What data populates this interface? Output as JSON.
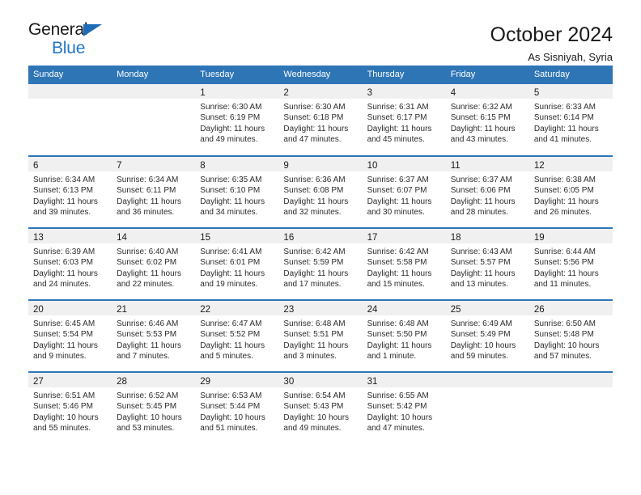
{
  "brand": {
    "name_dark": "General",
    "name_blue": "Blue",
    "accent_color": "#2277c8",
    "triangle_color": "#1e6bb8"
  },
  "header": {
    "title": "October 2024",
    "subtitle": "As Sisniyah, Syria"
  },
  "theme": {
    "header_bar_color": "#2e75b6",
    "daynum_band_color": "#f0f0f0",
    "row_divider_color": "#2e75b6"
  },
  "weekday_headers": [
    "Sunday",
    "Monday",
    "Tuesday",
    "Wednesday",
    "Thursday",
    "Friday",
    "Saturday"
  ],
  "weeks": [
    [
      {
        "day": "",
        "lines": []
      },
      {
        "day": "",
        "lines": []
      },
      {
        "day": "1",
        "lines": [
          "Sunrise: 6:30 AM",
          "Sunset: 6:19 PM",
          "Daylight: 11 hours",
          "and 49 minutes."
        ]
      },
      {
        "day": "2",
        "lines": [
          "Sunrise: 6:30 AM",
          "Sunset: 6:18 PM",
          "Daylight: 11 hours",
          "and 47 minutes."
        ]
      },
      {
        "day": "3",
        "lines": [
          "Sunrise: 6:31 AM",
          "Sunset: 6:17 PM",
          "Daylight: 11 hours",
          "and 45 minutes."
        ]
      },
      {
        "day": "4",
        "lines": [
          "Sunrise: 6:32 AM",
          "Sunset: 6:15 PM",
          "Daylight: 11 hours",
          "and 43 minutes."
        ]
      },
      {
        "day": "5",
        "lines": [
          "Sunrise: 6:33 AM",
          "Sunset: 6:14 PM",
          "Daylight: 11 hours",
          "and 41 minutes."
        ]
      }
    ],
    [
      {
        "day": "6",
        "lines": [
          "Sunrise: 6:34 AM",
          "Sunset: 6:13 PM",
          "Daylight: 11 hours",
          "and 39 minutes."
        ]
      },
      {
        "day": "7",
        "lines": [
          "Sunrise: 6:34 AM",
          "Sunset: 6:11 PM",
          "Daylight: 11 hours",
          "and 36 minutes."
        ]
      },
      {
        "day": "8",
        "lines": [
          "Sunrise: 6:35 AM",
          "Sunset: 6:10 PM",
          "Daylight: 11 hours",
          "and 34 minutes."
        ]
      },
      {
        "day": "9",
        "lines": [
          "Sunrise: 6:36 AM",
          "Sunset: 6:08 PM",
          "Daylight: 11 hours",
          "and 32 minutes."
        ]
      },
      {
        "day": "10",
        "lines": [
          "Sunrise: 6:37 AM",
          "Sunset: 6:07 PM",
          "Daylight: 11 hours",
          "and 30 minutes."
        ]
      },
      {
        "day": "11",
        "lines": [
          "Sunrise: 6:37 AM",
          "Sunset: 6:06 PM",
          "Daylight: 11 hours",
          "and 28 minutes."
        ]
      },
      {
        "day": "12",
        "lines": [
          "Sunrise: 6:38 AM",
          "Sunset: 6:05 PM",
          "Daylight: 11 hours",
          "and 26 minutes."
        ]
      }
    ],
    [
      {
        "day": "13",
        "lines": [
          "Sunrise: 6:39 AM",
          "Sunset: 6:03 PM",
          "Daylight: 11 hours",
          "and 24 minutes."
        ]
      },
      {
        "day": "14",
        "lines": [
          "Sunrise: 6:40 AM",
          "Sunset: 6:02 PM",
          "Daylight: 11 hours",
          "and 22 minutes."
        ]
      },
      {
        "day": "15",
        "lines": [
          "Sunrise: 6:41 AM",
          "Sunset: 6:01 PM",
          "Daylight: 11 hours",
          "and 19 minutes."
        ]
      },
      {
        "day": "16",
        "lines": [
          "Sunrise: 6:42 AM",
          "Sunset: 5:59 PM",
          "Daylight: 11 hours",
          "and 17 minutes."
        ]
      },
      {
        "day": "17",
        "lines": [
          "Sunrise: 6:42 AM",
          "Sunset: 5:58 PM",
          "Daylight: 11 hours",
          "and 15 minutes."
        ]
      },
      {
        "day": "18",
        "lines": [
          "Sunrise: 6:43 AM",
          "Sunset: 5:57 PM",
          "Daylight: 11 hours",
          "and 13 minutes."
        ]
      },
      {
        "day": "19",
        "lines": [
          "Sunrise: 6:44 AM",
          "Sunset: 5:56 PM",
          "Daylight: 11 hours",
          "and 11 minutes."
        ]
      }
    ],
    [
      {
        "day": "20",
        "lines": [
          "Sunrise: 6:45 AM",
          "Sunset: 5:54 PM",
          "Daylight: 11 hours",
          "and 9 minutes."
        ]
      },
      {
        "day": "21",
        "lines": [
          "Sunrise: 6:46 AM",
          "Sunset: 5:53 PM",
          "Daylight: 11 hours",
          "and 7 minutes."
        ]
      },
      {
        "day": "22",
        "lines": [
          "Sunrise: 6:47 AM",
          "Sunset: 5:52 PM",
          "Daylight: 11 hours",
          "and 5 minutes."
        ]
      },
      {
        "day": "23",
        "lines": [
          "Sunrise: 6:48 AM",
          "Sunset: 5:51 PM",
          "Daylight: 11 hours",
          "and 3 minutes."
        ]
      },
      {
        "day": "24",
        "lines": [
          "Sunrise: 6:48 AM",
          "Sunset: 5:50 PM",
          "Daylight: 11 hours",
          "and 1 minute."
        ]
      },
      {
        "day": "25",
        "lines": [
          "Sunrise: 6:49 AM",
          "Sunset: 5:49 PM",
          "Daylight: 10 hours",
          "and 59 minutes."
        ]
      },
      {
        "day": "26",
        "lines": [
          "Sunrise: 6:50 AM",
          "Sunset: 5:48 PM",
          "Daylight: 10 hours",
          "and 57 minutes."
        ]
      }
    ],
    [
      {
        "day": "27",
        "lines": [
          "Sunrise: 6:51 AM",
          "Sunset: 5:46 PM",
          "Daylight: 10 hours",
          "and 55 minutes."
        ]
      },
      {
        "day": "28",
        "lines": [
          "Sunrise: 6:52 AM",
          "Sunset: 5:45 PM",
          "Daylight: 10 hours",
          "and 53 minutes."
        ]
      },
      {
        "day": "29",
        "lines": [
          "Sunrise: 6:53 AM",
          "Sunset: 5:44 PM",
          "Daylight: 10 hours",
          "and 51 minutes."
        ]
      },
      {
        "day": "30",
        "lines": [
          "Sunrise: 6:54 AM",
          "Sunset: 5:43 PM",
          "Daylight: 10 hours",
          "and 49 minutes."
        ]
      },
      {
        "day": "31",
        "lines": [
          "Sunrise: 6:55 AM",
          "Sunset: 5:42 PM",
          "Daylight: 10 hours",
          "and 47 minutes."
        ]
      },
      {
        "day": "",
        "lines": []
      },
      {
        "day": "",
        "lines": []
      }
    ]
  ]
}
